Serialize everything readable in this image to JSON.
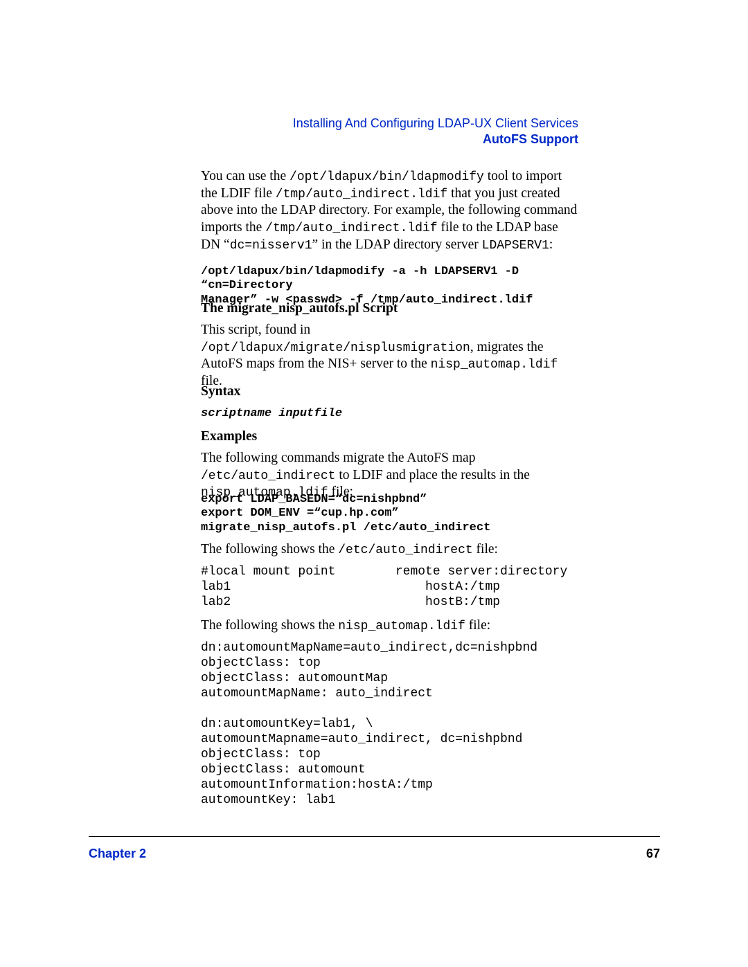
{
  "header": {
    "line1": "Installing And Configuring LDAP-UX Client Services",
    "line2": "AutoFS Support"
  },
  "p1": {
    "t1": "You can use the ",
    "c1": "/opt/ldapux/bin/ldapmodify",
    "t2": " tool to import the LDIF file ",
    "c2": "/tmp/auto_indirect.ldif",
    "t3": " that you just created above into the LDAP directory. For example, the following command imports the ",
    "c3": "/tmp/auto_indirect.ldif",
    "t4": " file to the LDAP base DN “",
    "c4": "dc=nisserv1",
    "t5": "” in the LDAP directory server ",
    "c5": "LDAPSERV1",
    "t6": ":"
  },
  "cmd1": "/opt/ldapux/bin/ldapmodify -a -h LDAPSERV1 -D “cn=Directory\nManager” -w <passwd> -f /tmp/auto_indirect.ldif",
  "h_script": "The migrate_nisp_autofs.pl Script",
  "p2": {
    "t1": "This script, found in ",
    "c1": "/opt/ldapux/migrate/nisplusmigration",
    "t2": ", migrates the AutoFS maps from the NIS+ server to the ",
    "c2": "nisp_automap.ldif",
    "t3": " file."
  },
  "h_syntax": "Syntax",
  "syntax_line": "scriptname inputfile",
  "h_examples": "Examples",
  "p3": {
    "t1": "The following commands migrate the AutoFS map ",
    "c1": "/etc/auto_indirect",
    "t2": " to LDIF and place the results in the ",
    "c2": "nisp_automap.ldif",
    "t3": " file:"
  },
  "cmd2": "export LDAP_BASEDN=“dc=nishpbnd”\nexport DOM_ENV =“cup.hp.com”\nmigrate_nisp_autofs.pl /etc/auto_indirect",
  "p4": {
    "t1": "The following shows the ",
    "c1": "/etc/auto_indirect",
    "t2": " file:"
  },
  "code1": "#local mount point        remote server:directory\nlab1                          hostA:/tmp\nlab2                          hostB:/tmp",
  "p5": {
    "t1": "The following shows the ",
    "c1": "nisp_automap.ldif",
    "t2": " file:"
  },
  "code2": "dn:automountMapName=auto_indirect,dc=nishpbnd\nobjectClass: top\nobjectClass: automountMap\nautomountMapName: auto_indirect\n\ndn:automountKey=lab1, \\\nautomountMapname=auto_indirect, dc=nishpbnd\nobjectClass: top\nobjectClass: automount\nautomountInformation:hostA:/tmp\nautomountKey: lab1",
  "footer": {
    "chapter": "Chapter 2",
    "page": "67"
  }
}
